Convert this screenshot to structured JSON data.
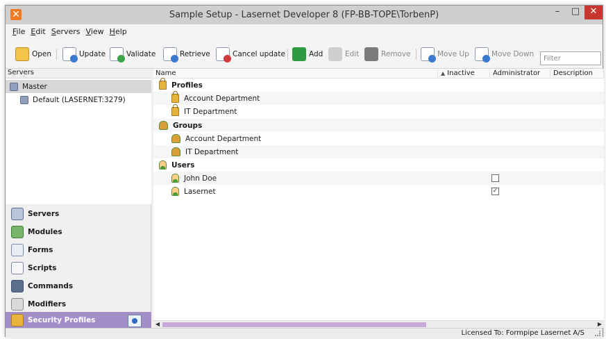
{
  "window": {
    "title": "Sample Setup - Lasernet Developer 8 (FP-BB-TOPE\\TorbenP)",
    "minimize_glyph": "–",
    "maximize_glyph": "□",
    "close_glyph": "✕",
    "app_icon_glyph": "✕"
  },
  "menu": [
    {
      "key": "F",
      "rest": "ile"
    },
    {
      "key": "E",
      "rest": "dit"
    },
    {
      "key": "S",
      "rest": "ervers"
    },
    {
      "key": "V",
      "rest": "iew"
    },
    {
      "key": "H",
      "rest": "elp"
    }
  ],
  "toolbar": {
    "open": "Open",
    "update": "Update",
    "validate": "Validate",
    "retrieve": "Retrieve",
    "cancel_update": "Cancel update",
    "add": "Add",
    "edit": "Edit",
    "remove": "Remove",
    "move_up": "Move Up",
    "move_down": "Move Down",
    "filter_placeholder": "Filter"
  },
  "left_panel": {
    "header": "Servers",
    "tree": [
      {
        "label": "Master",
        "selected": true
      },
      {
        "label": "Default (LASERNET:3279)",
        "selected": false
      }
    ],
    "nav": [
      {
        "label": "Servers",
        "icon": "server-icon"
      },
      {
        "label": "Modules",
        "icon": "modules-icon"
      },
      {
        "label": "Forms",
        "icon": "forms-icon"
      },
      {
        "label": "Scripts",
        "icon": "scripts-icon"
      },
      {
        "label": "Commands",
        "icon": "commands-icon"
      },
      {
        "label": "Modifiers",
        "icon": "modifiers-icon"
      },
      {
        "label": "Security Profiles",
        "icon": "lock-icon",
        "active": true
      }
    ]
  },
  "list": {
    "columns": {
      "name": "Name",
      "inactive": "Inactive",
      "administrator": "Administrator",
      "description": "Description"
    },
    "rows": [
      {
        "label": "Profiles",
        "type": "group",
        "icon": "lock-icon"
      },
      {
        "label": "Account Department",
        "type": "profile",
        "icon": "lock-icon"
      },
      {
        "label": "IT Department",
        "type": "profile",
        "icon": "lock-icon"
      },
      {
        "label": "Groups",
        "type": "group",
        "icon": "group-icon"
      },
      {
        "label": "Account Department",
        "type": "group-item",
        "icon": "group-icon"
      },
      {
        "label": "IT Department",
        "type": "group-item",
        "icon": "group-icon"
      },
      {
        "label": "Users",
        "type": "group",
        "icon": "user-icon"
      },
      {
        "label": "John Doe",
        "type": "user",
        "icon": "user-icon",
        "administrator": false
      },
      {
        "label": "Lasernet",
        "type": "user",
        "icon": "user-icon",
        "administrator": true
      }
    ]
  },
  "status": {
    "license": "Licensed To: Formpipe Lasernet A/S"
  },
  "colors": {
    "active_nav": "#a38ec8",
    "close_button": "#c7372f",
    "scroll_thumb": "#c7a9d9"
  }
}
